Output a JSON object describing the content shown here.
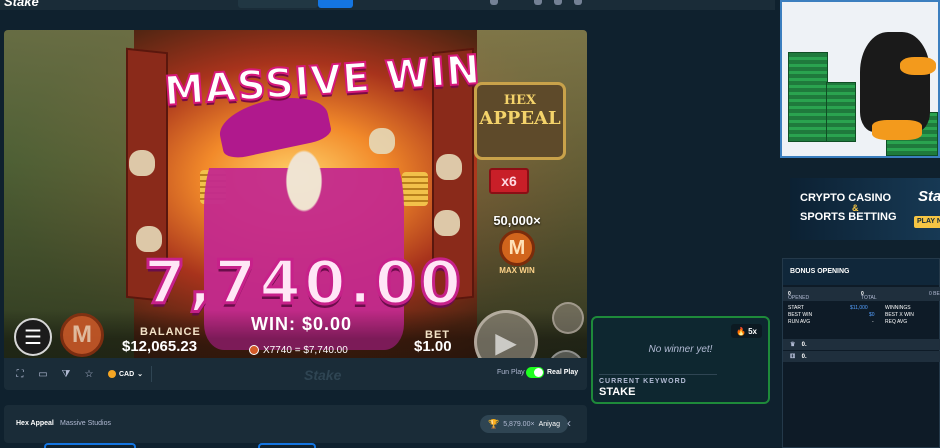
{
  "site": {
    "logo": "Stake"
  },
  "game": {
    "banner_text": "MASSIVE WIN",
    "win_amount_big": "7,740.00",
    "logo_line1": "HEX",
    "logo_line2": "APPEAL",
    "multiplier": "x6",
    "maxwin_value": "50,000×",
    "maxwin_coin": "M",
    "maxwin_label": "MAX WIN",
    "menu_icon": "menu-icon",
    "m_button": "M",
    "balance_label": "BALANCE",
    "balance_value": "$12,065.23",
    "win_label": "WIN: $0.00",
    "win_detail": "X7740 = $7,740.00",
    "bet_label": "BET",
    "bet_value": "$1.00",
    "spin_icon": "▶",
    "auto_icon": "↻"
  },
  "toolbar": {
    "currency": "CAD",
    "watermark": "Stake",
    "fun_play": "Fun Play",
    "real_play": "Real Play",
    "real_play_enabled": true
  },
  "info": {
    "title": "Hex Appeal",
    "studio": "Massive Studios",
    "record_value": "5,879.00×",
    "record_user": "Aniyag"
  },
  "banner": {
    "line1": "CRYPTO CASINO",
    "amp": "&",
    "line2": "SPORTS BETTING",
    "brand": "Sta",
    "play": "PLAY N"
  },
  "bonus": {
    "header": "BONUS OPENING",
    "opened_label": "OPENED",
    "opened_value": "0",
    "total_label": "TOTAL",
    "total_value": "0",
    "trailing": "0 BE",
    "start_label": "START",
    "start_value": "$11,000",
    "winnings_label": "WINNINGS",
    "best_win_label": "BEST WIN",
    "best_win_value": "$0",
    "best_x_label": "BEST X WIN",
    "run_avg_label": "RUN AVG",
    "run_avg_value": "-",
    "req_avg_label": "REQ AVG",
    "list": [
      {
        "icon": "♛",
        "value": "0."
      },
      {
        "icon": "⚅",
        "value": "0."
      }
    ]
  },
  "winner_widget": {
    "badge": "5x",
    "message": "No winner yet!",
    "keyword_label": "CURRENT KEYWORD",
    "keyword": "STAKE"
  }
}
